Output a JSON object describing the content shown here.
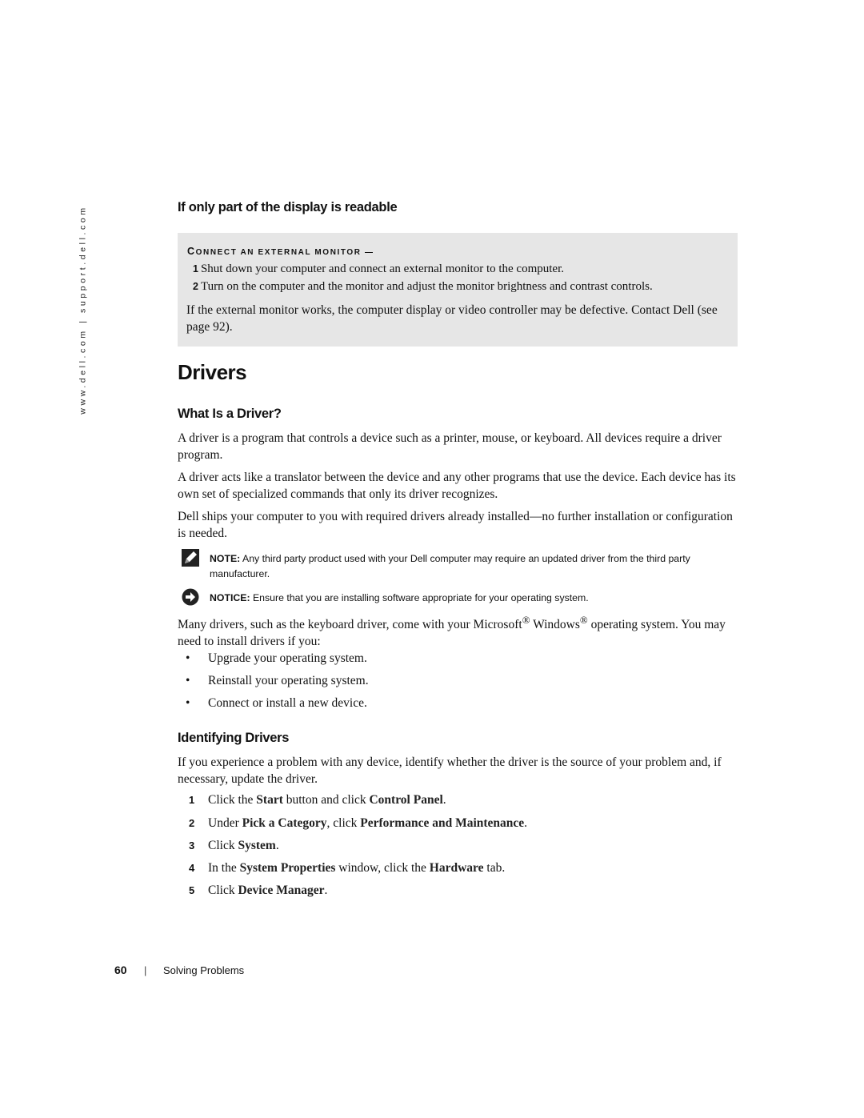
{
  "side_url": "www.dell.com | support.dell.com",
  "section1": {
    "heading": "If only part of the display is readable",
    "box": {
      "label_first": "C",
      "label_rest": "ONNECT AN EXTERNAL MONITOR —",
      "steps": [
        {
          "num": "1",
          "text": "Shut down your computer and connect an external monitor to the computer."
        },
        {
          "num": "2",
          "text": "Turn on the computer and the monitor and adjust the monitor brightness and contrast controls."
        }
      ],
      "para": "If the external monitor works, the computer display or video controller may be defective. Contact Dell (see page 92)."
    }
  },
  "title": "Drivers",
  "section2": {
    "heading": "What Is a Driver?",
    "paragraphs": [
      "A driver is a program that controls a device such as a printer, mouse, or keyboard. All devices require a driver program.",
      "A driver acts like a translator between the device and any other programs that use the device. Each device has its own set of specialized commands that only its driver recognizes.",
      "Dell ships your computer to you with required drivers already installed—no further installation or configuration is needed."
    ],
    "note": {
      "icon": "pencil-note-icon",
      "label": "NOTE:",
      "text": "Any third party product used with your Dell computer may require an updated driver from the third party manufacturer."
    },
    "notice": {
      "icon": "notice-arrow-icon",
      "label": "NOTICE:",
      "text": "Ensure that you are installing software appropriate for your operating system."
    },
    "intro_parts": [
      "Many drivers, such as the keyboard driver, come with your Microsoft",
      "®",
      " Windows",
      "®",
      " operating system. You may need to install drivers if you:"
    ],
    "bullets": [
      "Upgrade your operating system.",
      "Reinstall your operating system.",
      "Connect or install a new device."
    ]
  },
  "section3": {
    "heading": "Identifying Drivers",
    "para": "If you experience a problem with any device, identify whether the driver is the source of your problem and, if necessary, update the driver.",
    "steps": [
      {
        "num": "1",
        "parts": [
          "Click the ",
          "Start",
          " button and click ",
          "Control Panel",
          "."
        ]
      },
      {
        "num": "2",
        "parts": [
          "Under ",
          "Pick a Category",
          ", click ",
          "Performance and Maintenance",
          "."
        ]
      },
      {
        "num": "3",
        "parts": [
          "Click ",
          "System",
          ".",
          "",
          ""
        ]
      },
      {
        "num": "4",
        "parts": [
          "In the ",
          "System Properties",
          " window, click the ",
          "Hardware",
          " tab."
        ]
      },
      {
        "num": "5",
        "parts": [
          "Click ",
          "Device Manager",
          ".",
          "",
          ""
        ]
      }
    ]
  },
  "footer": {
    "page_number": "60",
    "separator": "|",
    "section": "Solving Problems"
  }
}
